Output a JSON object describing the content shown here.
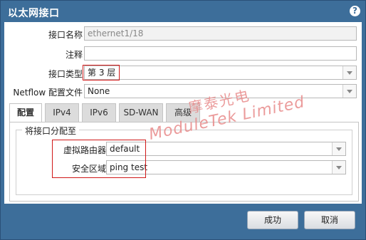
{
  "dialog": {
    "title": "以太网接口",
    "help_icon": "?"
  },
  "form": {
    "interface_name": {
      "label": "接口名称",
      "value": "ethernet1/18"
    },
    "comment": {
      "label": "注释",
      "value": ""
    },
    "interface_type": {
      "label": "接口类型",
      "value": "第 3 层"
    },
    "netflow": {
      "label": "Netflow 配置文件",
      "value": "None"
    }
  },
  "tabs": [
    "配置",
    "IPv4",
    "IPv6",
    "SD-WAN",
    "高级"
  ],
  "assign": {
    "legend": "将接口分配至",
    "virtual_router": {
      "label": "虚拟路由器",
      "value": "default"
    },
    "security_zone": {
      "label": "安全区域",
      "value": "ping test"
    }
  },
  "watermark": {
    "line1": "摩泰光电",
    "line2": "ModuleTek Limited"
  },
  "buttons": {
    "ok": "成功",
    "cancel": "取消"
  },
  "colors": {
    "titlebar": "#3d6e9a",
    "highlight": "#d01818",
    "watermark": "#e88a8a"
  }
}
